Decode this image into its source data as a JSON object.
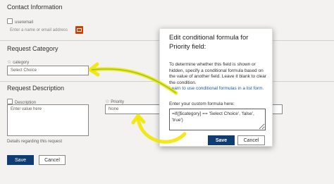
{
  "form": {
    "contact_section_title": "Contact Information",
    "user_email_label": "useremail",
    "user_email_placeholder": "Enter a name or email address",
    "request_category_title": "Request Category",
    "category_label": "category",
    "category_value": "Select Choice",
    "request_description_title": "Request Description",
    "description_label": "Description",
    "description_placeholder": "Enter value here",
    "description_hint": "Details regarding this request",
    "priority_label": "Priority",
    "priority_value": "None",
    "save_label": "Save",
    "cancel_label": "Cancel"
  },
  "dialog": {
    "title": "Edit conditional formula for Priority field:",
    "description": "To determine whether this field is shown or hidden, specify a conditional formula based on the value of another field. Leave it blank to clear the condition.",
    "link_text": "Learn to use conditional formulas in a list form.",
    "enter_label": "Enter your custom formula here:",
    "formula_value": "=if([$category] == 'Select Choice', 'false', 'true')",
    "save_label": "Save",
    "cancel_label": "Cancel"
  },
  "colors": {
    "primary_button": "#0f3c73",
    "link": "#0f5fa8",
    "annotation_arrow": "#f2e600"
  },
  "icons": {
    "user_field": "person-icon",
    "outlook": "outlook-icon",
    "category_field": "star-icon",
    "description_field": "text-icon",
    "priority_field": "star-icon"
  }
}
